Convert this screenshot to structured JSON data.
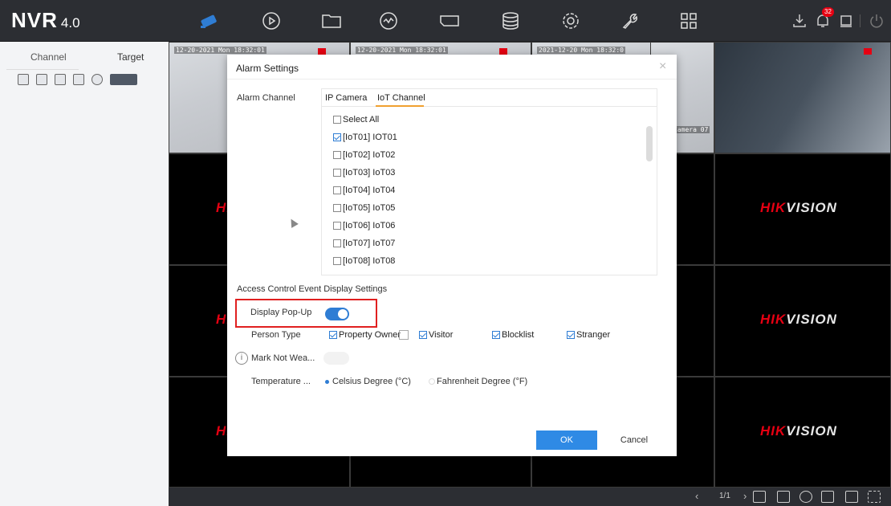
{
  "app": {
    "logo": "NVR",
    "version": "4.0"
  },
  "topbar": {
    "nav_icons": [
      "camera-icon",
      "playback-icon",
      "folder-icon",
      "smart-search-icon",
      "tag-icon",
      "storage-icon",
      "settings-icon",
      "maintenance-icon",
      "grid-icon"
    ],
    "right_icons": [
      "download-icon",
      "notification-icon",
      "alarm-icon",
      "power-icon"
    ],
    "notification_count": "32"
  },
  "left_panel": {
    "tabs": [
      "Channel",
      "Target"
    ]
  },
  "video": {
    "osd": [
      "12-20-2021 Mon 18:32:01",
      "12-20-2021 Mon 18:32:01",
      "2021-12-20 Mon 18:32:0",
      "Camera 07"
    ],
    "brand_red": "HIK",
    "brand_white": "VISION"
  },
  "dialog": {
    "title": "Alarm Settings",
    "alarm_channel_label": "Alarm Channel",
    "tabs": [
      "IP Camera",
      "IoT Channel"
    ],
    "select_all": "Select All",
    "channels": [
      {
        "label": "[IoT01] IOT01",
        "checked": true
      },
      {
        "label": "[IoT02] IoT02",
        "checked": false
      },
      {
        "label": "[IoT03] IoT03",
        "checked": false
      },
      {
        "label": "[IoT04] IoT04",
        "checked": false
      },
      {
        "label": "[IoT05] IoT05",
        "checked": false
      },
      {
        "label": "[IoT06] IoT06",
        "checked": false
      },
      {
        "label": "[IoT07] IoT07",
        "checked": false
      },
      {
        "label": "[IoT08] IoT08",
        "checked": false
      }
    ],
    "section_title": "Access Control Event Display Settings",
    "display_popup_label": "Display Pop-Up",
    "person_type_label": "Person Type",
    "person_types": [
      "Property Owner",
      "Visitor",
      "Blocklist",
      "Stranger"
    ],
    "mark_not_wear_label": "Mark Not Wea...",
    "temperature_label": "Temperature ...",
    "temp_options": [
      "Celsius Degree (°C)",
      "Fahrenheit Degree (°F)"
    ],
    "ok": "OK",
    "cancel": "Cancel"
  },
  "bottombar": {
    "page": "1/1"
  }
}
